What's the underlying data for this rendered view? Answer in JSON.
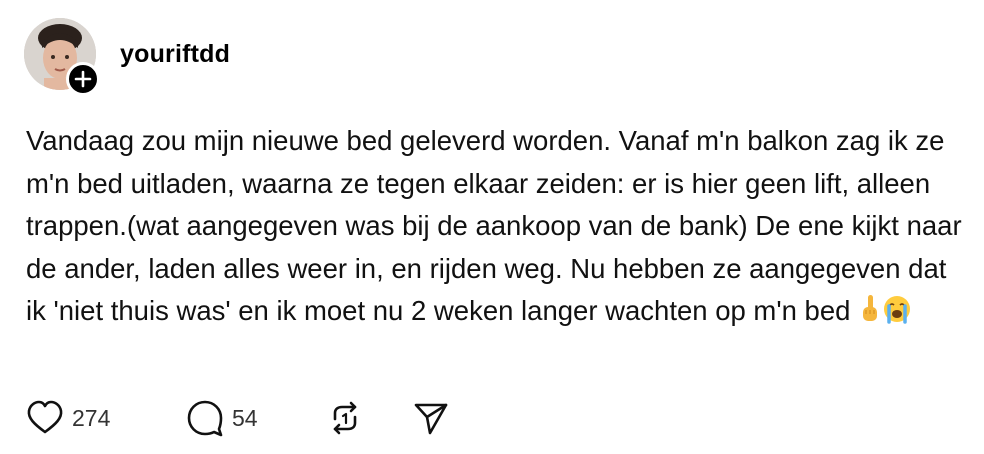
{
  "post": {
    "username": "youriftdd",
    "text": "Vandaag zou mijn nieuwe bed geleverd worden. Vanaf m'n balkon zag ik ze m'n bed uitladen, waarna ze tegen elkaar zeiden: er is hier geen lift, alleen trappen.(wat aangegeven was bij de aankoop van de bank) De ene kijkt naar de ander, laden alles weer in, en rijden weg. Nu hebben ze aangegeven dat ik 'niet thuis was' en ik moet nu 2 weken langer wachten op m'n bed",
    "emojis": [
      "middle-finger-emoji",
      "crying-face-emoji"
    ]
  },
  "actions": {
    "likes": "274",
    "comments": "54",
    "icons": [
      "heart-icon",
      "comment-icon",
      "repost-icon",
      "share-icon"
    ]
  },
  "colors": {
    "text": "#000000",
    "count": "#333333",
    "badge": "#000000"
  }
}
